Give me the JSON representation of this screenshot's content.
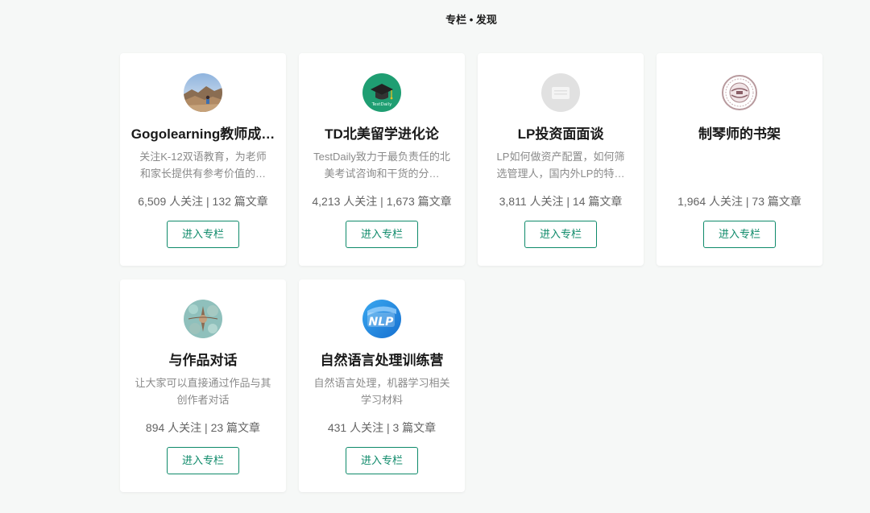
{
  "header": {
    "title": "专栏 • 发现"
  },
  "columns": [
    {
      "avatar_icon": "mountain-photo-avatar",
      "title": "Gogolearning教师成…",
      "description": "关注K-12双语教育，为老师和家长提供有参考价值的…",
      "stats": "6,509 人关注 | 132 篇文章",
      "button_label": "进入专栏"
    },
    {
      "avatar_icon": "graduation-cap-avatar",
      "title": "TD北美留学进化论",
      "description": "TestDaily致力于最负责任的北美考试咨询和干货的分…",
      "stats": "4,213 人关注 | 1,673 篇文章",
      "button_label": "进入专栏"
    },
    {
      "avatar_icon": "default-placeholder-avatar",
      "title": "LP投资面面谈",
      "description": "LP如何做资产配置，如何筛选管理人，国内外LP的特…",
      "stats": "3,811 人关注 | 14 篇文章",
      "button_label": "进入专栏"
    },
    {
      "avatar_icon": "stamp-seal-avatar",
      "title": "制琴师的书架",
      "description": "",
      "stats": "1,964 人关注 | 73 篇文章",
      "button_label": "进入专栏"
    },
    {
      "avatar_icon": "artwork-photo-avatar",
      "title": "与作品对话",
      "description": "让大家可以直接通过作品与其创作者对话",
      "stats": "894 人关注 | 23 篇文章",
      "button_label": "进入专栏"
    },
    {
      "avatar_icon": "nlp-logo-avatar",
      "title": "自然语言处理训练营",
      "description": "自然语言处理，机器学习相关学习材料",
      "stats": "431 人关注 | 3 篇文章",
      "button_label": "进入专栏"
    }
  ],
  "colors": {
    "accent": "#0e8a6a",
    "background": "#f6f8f7",
    "card": "#ffffff"
  }
}
